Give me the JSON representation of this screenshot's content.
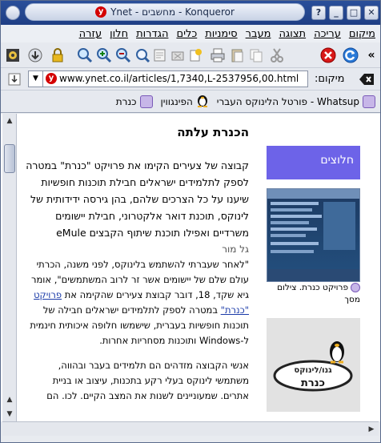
{
  "window": {
    "title": "Ynet - מחשבים - Konqueror",
    "favicon_letter": "y",
    "buttons": {
      "help": "?",
      "minimize": "_",
      "maximize": "□",
      "close": "✕"
    }
  },
  "menubar": {
    "items": [
      "מיקום",
      "עריכה",
      "תצוגה",
      "מעבר",
      "סימניות",
      "כלים",
      "הגדרות",
      "חלון",
      "עזרה"
    ]
  },
  "toolbar": {
    "more": "«"
  },
  "location": {
    "label": "מיקום:",
    "url": "www.ynet.co.il/articles/1,7340,L-2537956,00.html"
  },
  "bookmarks": {
    "items": [
      "פורטל הלינוקס העברי - Whatsup",
      "הפינגווין",
      "כנרת"
    ]
  },
  "article": {
    "title": "הכנרת עלתה",
    "lead": "קבוצה של צעירים הקימו את פרויקט \"כנרת\" במטרה לספק לתלמידים ישראלים חבילת תוכנות חופשיות שיענו על כל הצרכים שלהם, בהן גירסה ידידותית של לינוקס, תוכנת דואר אלקטרוני, חבילת יישומים משרדיים ואפילו תוכנת שיתוף הקבצים eMule",
    "author": "גל מור",
    "para1_before": "\"לאחר שעברתי להשתמש בלינוקס, לפני משנה, הכרתי עולם שלם של יישומים אשר זר לרוב המשתמשים\", אומר גיא שקד, 18, דובר קבוצת צעירים שהקימה את ",
    "para1_link": "פרויקט \"כנרת\"",
    "para1_after": " במטרה לספק לתלמידים ישראלים חבילה של תוכנות חופשיות בעברית, שישמשו חלופה איכותית חינמית ל-Windows ותוכנות מסחריות אחרות.",
    "para2": "אנשי הקבוצה מזדהים הם תלמידים בעבר ובהווה, משתמשי לינוקס בעלי רקע בתכנות, עיצוב או בניית אתרים. שמעוניינים לשנות את המצב הקיים. לכו. הם"
  },
  "sidebar": {
    "talkbacks": "חלוצים",
    "caption": "פרויקט כנרת. צילום מסך",
    "logo_top": "גנו/לינוקס",
    "logo_bottom": "כנרת"
  },
  "colors": {
    "titlebar": "#2a4f9a",
    "talkback_box": "#6d63e8",
    "link": "#1a3aa8",
    "favicon": "#d40000"
  }
}
